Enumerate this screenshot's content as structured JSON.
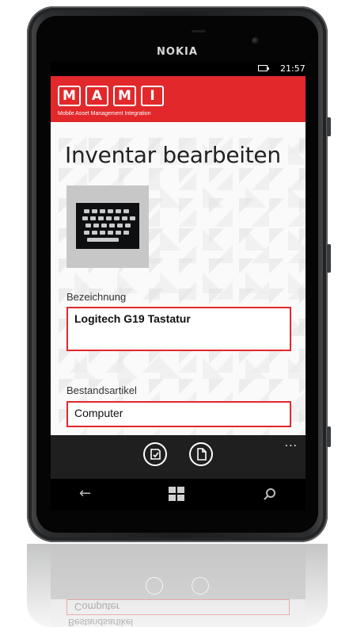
{
  "device": {
    "brand": "NOKIA",
    "status_time": "21:57"
  },
  "app": {
    "logo_letters": [
      "M",
      "A",
      "M",
      "I"
    ],
    "logo_subtitle": "Mobile Asset Management Integration",
    "page_title": "Inventar bearbeiten"
  },
  "form": {
    "bezeichnung_label": "Bezeichnung",
    "bezeichnung_value": "Logitech G19 Tastatur",
    "bestandsartikel_label": "Bestandsartikel",
    "bestandsartikel_value": "Computer"
  },
  "appbar": {
    "more": "...",
    "buttons": [
      "save-icon",
      "document-icon"
    ]
  },
  "navbar": {
    "back": "←",
    "icons": [
      "back-arrow-icon",
      "windows-icon",
      "search-icon"
    ]
  },
  "reflection": {
    "bestandsartikel_label": "Bestandsartikel",
    "bestandsartikel_value": "Computer"
  },
  "colors": {
    "accent": "#e2282b",
    "appbar": "#1f1f1f"
  }
}
